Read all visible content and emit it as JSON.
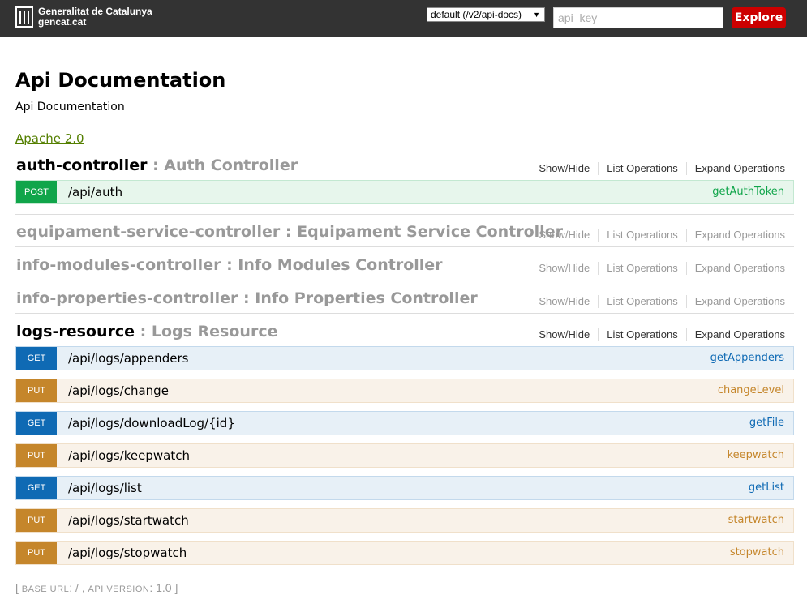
{
  "header": {
    "logo_line1": "Generalitat de Catalunya",
    "logo_line2": "gencat.cat",
    "spec_select_value": "default (/v2/api-docs)",
    "api_key_placeholder": "api_key",
    "explore_label": "Explore",
    "explore_color": "#cc0000"
  },
  "info": {
    "title": "Api Documentation",
    "description": "Api Documentation",
    "license": "Apache 2.0"
  },
  "options": {
    "show_hide": "Show/Hide",
    "list_operations": "List Operations",
    "expand_operations": "Expand Operations"
  },
  "resources": [
    {
      "name": "auth-controller",
      "description": " : Auth Controller",
      "operations": [
        {
          "method": "POST",
          "path": "/api/auth",
          "nickname": "getAuthToken"
        }
      ]
    },
    {
      "name": "equipament-service-controller",
      "description": " : Equipament Service Controller"
    },
    {
      "name": "info-modules-controller",
      "description": " : Info Modules Controller"
    },
    {
      "name": "info-properties-controller",
      "description": " : Info Properties Controller"
    },
    {
      "name": "logs-resource",
      "description": " : Logs Resource",
      "operations": [
        {
          "method": "GET",
          "path": "/api/logs/appenders",
          "nickname": "getAppenders"
        },
        {
          "method": "PUT",
          "path": "/api/logs/change",
          "nickname": "changeLevel"
        },
        {
          "method": "GET",
          "path": "/api/logs/downloadLog/{id}",
          "nickname": "getFile"
        },
        {
          "method": "PUT",
          "path": "/api/logs/keepwatch",
          "nickname": "keepwatch"
        },
        {
          "method": "GET",
          "path": "/api/logs/list",
          "nickname": "getList"
        },
        {
          "method": "PUT",
          "path": "/api/logs/startwatch",
          "nickname": "startwatch"
        },
        {
          "method": "PUT",
          "path": "/api/logs/stopwatch",
          "nickname": "stopwatch"
        }
      ]
    }
  ],
  "method_colors": {
    "POST": "#10a54a",
    "GET": "#0f6ab4",
    "PUT": "#c5862b"
  },
  "footer": {
    "open": "[ ",
    "base_url_label": "BASE URL",
    "base_url_value": ": / , ",
    "api_version_label": "API VERSION",
    "api_version_value": ": 1.0 ]"
  }
}
